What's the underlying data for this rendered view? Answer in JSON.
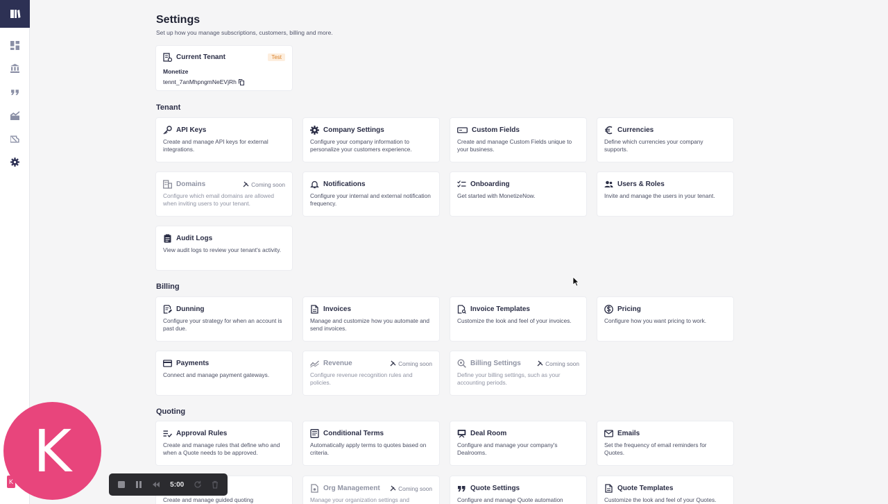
{
  "header": {
    "title": "Settings",
    "subtitle": "Set up how you manage subscriptions, customers, billing and more."
  },
  "current_tenant": {
    "title": "Current Tenant",
    "badge": "Test",
    "name": "Monetize",
    "id": "tennt_7anMhpngmNeEVjRh"
  },
  "sections": {
    "tenant": "Tenant",
    "billing": "Billing",
    "quoting": "Quoting"
  },
  "coming_soon": "Coming soon",
  "cards": {
    "api_keys": {
      "title": "API Keys",
      "desc": "Create and manage API keys for external integrations."
    },
    "company_settings": {
      "title": "Company Settings",
      "desc": "Configure your company information to personalize your customers experience."
    },
    "custom_fields": {
      "title": "Custom Fields",
      "desc": "Create and manage Custom Fields unique to your business."
    },
    "currencies": {
      "title": "Currencies",
      "desc": "Define which currencies your company supports."
    },
    "domains": {
      "title": "Domains",
      "desc": "Configure which email domains are allowed when inviting users to your tenant."
    },
    "notifications": {
      "title": "Notifications",
      "desc": "Configure your internal and external notification frequency."
    },
    "onboarding": {
      "title": "Onboarding",
      "desc": "Get started with MonetizeNow."
    },
    "users_roles": {
      "title": "Users & Roles",
      "desc": "Invite and manage the users in your tenant."
    },
    "audit_logs": {
      "title": "Audit Logs",
      "desc": "View audit logs to review your tenant's activity."
    },
    "dunning": {
      "title": "Dunning",
      "desc": "Configure your strategy for when an account is past due."
    },
    "invoices": {
      "title": "Invoices",
      "desc": "Manage and customize how you automate and send invoices."
    },
    "invoice_templates": {
      "title": "Invoice Templates",
      "desc": "Customize the look and feel of your invoices."
    },
    "pricing": {
      "title": "Pricing",
      "desc": "Configure how you want pricing to work."
    },
    "payments": {
      "title": "Payments",
      "desc": "Connect and manage payment gateways."
    },
    "revenue": {
      "title": "Revenue",
      "desc": "Configure revenue recognition rules and policies."
    },
    "billing_settings": {
      "title": "Billing Settings",
      "desc": "Define your billing settings, such as your accounting periods."
    },
    "approval_rules": {
      "title": "Approval Rules",
      "desc": "Create and manage rules that define who and when a Quote needs to be approved."
    },
    "conditional_terms": {
      "title": "Conditional Terms",
      "desc": "Automatically apply terms to quotes based on criteria."
    },
    "deal_room": {
      "title": "Deal Room",
      "desc": "Configure and manage your company's Dealrooms."
    },
    "emails": {
      "title": "Emails",
      "desc": "Set the frequency of email reminders for Quotes."
    },
    "guided_quoting": {
      "title": "",
      "desc": "Create and manage guided quoting"
    },
    "org_management": {
      "title": "Org Management",
      "desc": "Manage your organization settings and"
    },
    "quote_settings": {
      "title": "Quote Settings",
      "desc": "Configure and manage Quote automation"
    },
    "quote_templates": {
      "title": "Quote Templates",
      "desc": "Customize the look and feel of your Quotes."
    }
  },
  "recorder": {
    "time": "5:00"
  },
  "avatar": {
    "initial": "K",
    "mini": "K"
  },
  "colors": {
    "sidebar_logo": "#2d3154",
    "avatar": "#e8457c",
    "badge_bg": "#fdeede",
    "badge_text": "#d9822b"
  }
}
